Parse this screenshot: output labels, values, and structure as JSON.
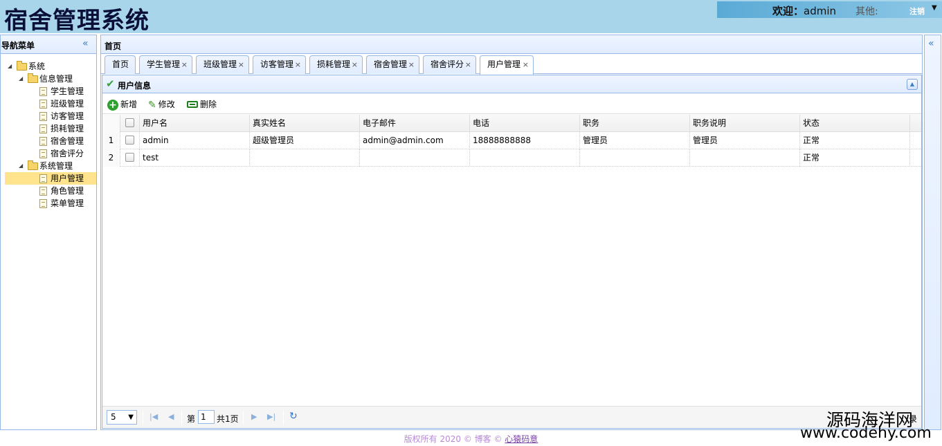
{
  "header": {
    "app_title": "宿舍管理系统",
    "welcome_label": "欢迎：",
    "username": "admin",
    "others_label": "其他:",
    "logout_label": "注销"
  },
  "nav": {
    "title": "导航菜单",
    "tree": [
      {
        "label": "系统",
        "type": "folder",
        "level": 0
      },
      {
        "label": "信息管理",
        "type": "folder",
        "level": 1
      },
      {
        "label": "学生管理",
        "type": "file",
        "level": 2
      },
      {
        "label": "班级管理",
        "type": "file",
        "level": 2
      },
      {
        "label": "访客管理",
        "type": "file",
        "level": 2
      },
      {
        "label": "损耗管理",
        "type": "file",
        "level": 2
      },
      {
        "label": "宿舍管理",
        "type": "file",
        "level": 2
      },
      {
        "label": "宿舍评分",
        "type": "file",
        "level": 2
      },
      {
        "label": "系统管理",
        "type": "folder",
        "level": 1
      },
      {
        "label": "用户管理",
        "type": "file",
        "level": 2,
        "selected": true
      },
      {
        "label": "角色管理",
        "type": "file",
        "level": 2
      },
      {
        "label": "菜单管理",
        "type": "file",
        "level": 2
      }
    ]
  },
  "center": {
    "title": "首页",
    "tabs": [
      {
        "label": "首页",
        "closable": false
      },
      {
        "label": "学生管理",
        "closable": true
      },
      {
        "label": "班级管理",
        "closable": true
      },
      {
        "label": "访客管理",
        "closable": true
      },
      {
        "label": "损耗管理",
        "closable": true
      },
      {
        "label": "宿舍管理",
        "closable": true
      },
      {
        "label": "宿舍评分",
        "closable": true
      },
      {
        "label": "用户管理",
        "closable": true,
        "active": true
      }
    ],
    "close_glyph": "×"
  },
  "panel": {
    "title": "用户信息",
    "toolbar": {
      "add": "新增",
      "edit": "修改",
      "delete": "删除"
    },
    "columns": [
      "用户名",
      "真实姓名",
      "电子邮件",
      "电话",
      "职务",
      "职务说明",
      "状态"
    ],
    "rows": [
      {
        "num": "1",
        "cells": [
          "admin",
          "超级管理员",
          "admin@admin.com",
          "18888888888",
          "管理员",
          "管理员",
          "正常"
        ]
      },
      {
        "num": "2",
        "cells": [
          "test",
          "",
          "",
          "",
          "",
          "",
          "正常"
        ]
      }
    ]
  },
  "pager": {
    "page_size": "5",
    "page_prefix": "第",
    "page_value": "1",
    "page_total": "共1页",
    "info_suffix": "录"
  },
  "footer": {
    "text": "版权所有 2020 © 博客 © ",
    "link": "心猿码意"
  },
  "watermark": {
    "line1": "源码海洋网",
    "line2": "www.codehy.com"
  },
  "colors": {
    "header_bg": "#a9d5ea",
    "panel_border": "#95b8e7",
    "selected_node": "#ffe48d"
  }
}
